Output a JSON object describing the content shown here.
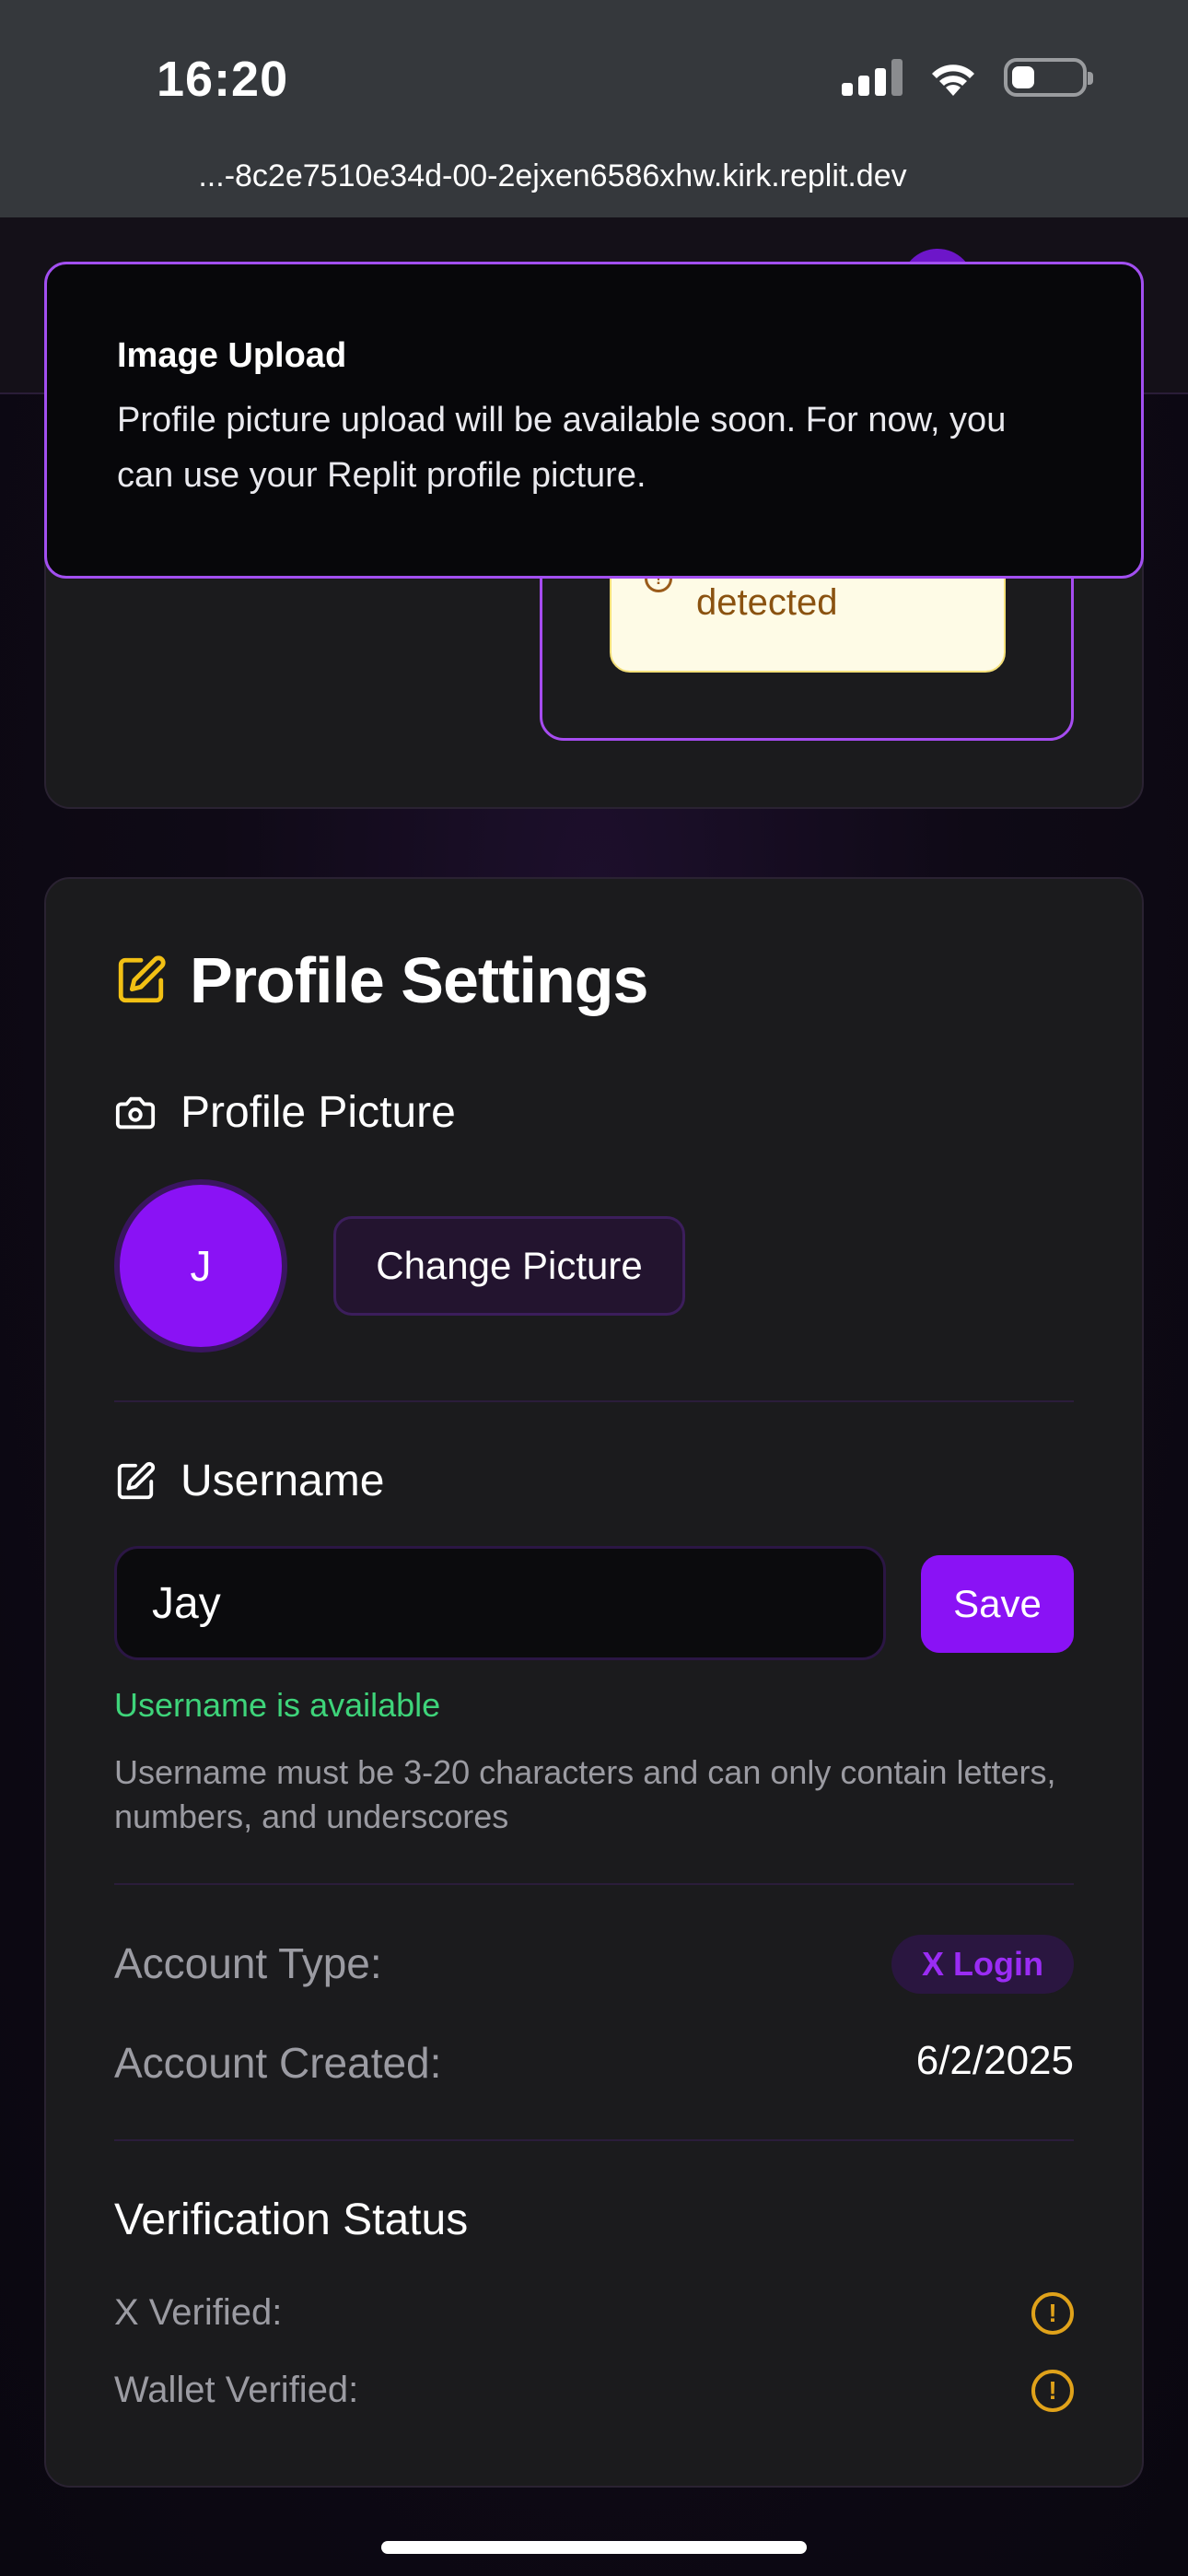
{
  "status_bar": {
    "time": "16:20",
    "url": "...-8c2e7510e34d-00-2ejxen6586xhw.kirk.replit.dev"
  },
  "wallet_warning": {
    "text": "detected"
  },
  "toast": {
    "title": "Image Upload",
    "body": "Profile picture upload will be available soon. For now, you can use your Replit profile picture."
  },
  "profile": {
    "title": "Profile Settings",
    "picture_label": "Profile Picture",
    "avatar_initial": "J",
    "change_picture_label": "Change Picture",
    "username_label": "Username",
    "username_value": "Jay",
    "save_label": "Save",
    "availability": "Username is available",
    "hint": "Username must be 3-20 characters and can only contain letters, numbers, and underscores",
    "account_type_label": "Account Type:",
    "account_type_badge": "X Login",
    "account_created_label": "Account Created:",
    "account_created_value": "6/2/2025",
    "verification_title": "Verification Status",
    "x_verified_label": "X Verified:",
    "wallet_verified_label": "Wallet Verified:"
  },
  "colors": {
    "accent_purple": "#8a12f5",
    "toast_border": "#a24ff0",
    "success_green": "#3ed47a",
    "warning_amber": "#e0a21a",
    "title_icon_yellow": "#f2c014"
  },
  "icons": {
    "title_icon": "edit-square-icon",
    "picture_icon": "camera-icon",
    "username_icon": "edit-square-icon",
    "x_verified_icon": "alert-circle-icon",
    "wallet_verified_icon": "alert-circle-icon",
    "warning_icon": "info-circle-icon"
  }
}
